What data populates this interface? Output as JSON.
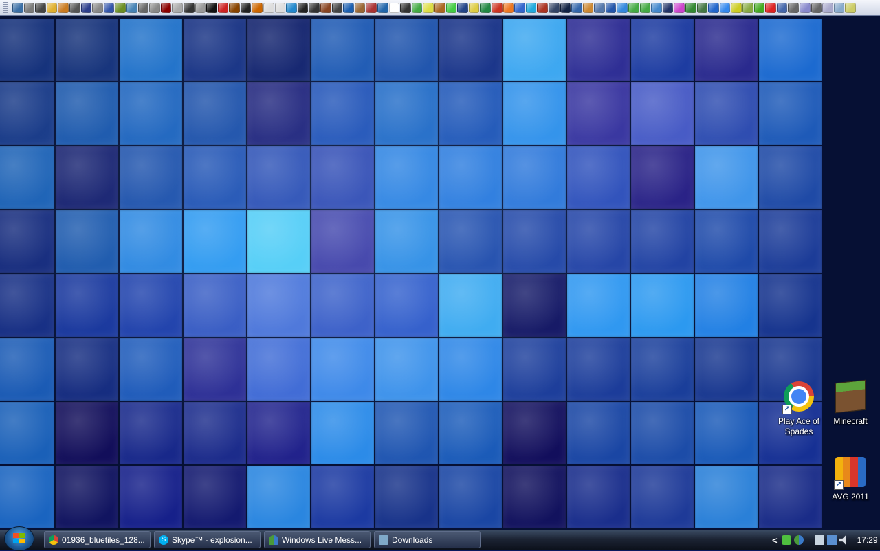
{
  "quicklaunch": {
    "icon_colors": [
      "#3a6ea5",
      "#7a7a7a",
      "#444444",
      "#e0b030",
      "#c97a20",
      "#555555",
      "#2c3e8c",
      "#888888",
      "#3355aa",
      "#6b8e23",
      "#4682b4",
      "#666666",
      "#888888",
      "#8b0000",
      "#aaaaaa",
      "#333333",
      "#999999",
      "#111111",
      "#cc2222",
      "#884400",
      "#222222",
      "#cc6600",
      "#dddddd",
      "#dddddd",
      "#2288cc",
      "#222222",
      "#333333",
      "#884422",
      "#444444",
      "#1c5fb0",
      "#996633",
      "#aa3333",
      "#2266aa",
      "#ffffff",
      "#333333",
      "#44aa44",
      "#dddd44",
      "#aa6622",
      "#44cc44",
      "#224488",
      "#ddcc44",
      "#228844",
      "#cc3322",
      "#ee7722",
      "#3366cc",
      "#22aadd",
      "#aa3322",
      "#334466",
      "#112244",
      "#3366aa",
      "#cc8833",
      "#5577aa",
      "#2255aa",
      "#3388dd",
      "#44aa44",
      "#44aa44",
      "#4488cc",
      "#223366",
      "#cc44cc",
      "#338833",
      "#447744",
      "#2266cc",
      "#3388ee",
      "#cccc22",
      "#88aa44",
      "#44aa22",
      "#dd2222",
      "#4466aa",
      "#666666",
      "#8888cc",
      "#666666",
      "#aaaacc",
      "#88aacc",
      "#cccc66"
    ]
  },
  "desktop_icons": [
    {
      "label": "Play Ace of Spades",
      "icon": "chrome-icon"
    },
    {
      "label": "Minecraft",
      "icon": "minecraft-icon"
    },
    {
      "label": "AVG 2011",
      "icon": "avg-icon"
    }
  ],
  "taskbar": {
    "buttons": [
      {
        "label": "01936_bluetiles_128...",
        "icon": "chrome-icon",
        "color": "#db4437"
      },
      {
        "label": "Skype™ - explosion...",
        "icon": "skype-icon",
        "color": "#00aff0"
      },
      {
        "label": "Windows Live Mess...",
        "icon": "messenger-icon",
        "color": "#4a9a3a"
      },
      {
        "label": "Downloads",
        "icon": "folder-icon",
        "color": "#7fa9c9"
      }
    ],
    "tray": {
      "chevron": "<",
      "icons": [
        "avg-tray-icon",
        "messenger-tray-icon",
        "usb-icon",
        "network-icon",
        "volume-icon"
      ],
      "clock": "17:29"
    }
  },
  "wallpaper": {
    "tile_colors": [
      [
        "#14307a",
        "#143078",
        "#1f70c8",
        "#152e80",
        "#0f1d68",
        "#1a55b0",
        "#1a4ea8",
        "#152e84",
        "#3aa6f0",
        "#2c2a92",
        "#1c3aa0",
        "#2a2a8e",
        "#1c6ad0"
      ],
      [
        "#173886",
        "#1a56aa",
        "#1c62bc",
        "#1b4da6",
        "#1e1e76",
        "#1f4fb4",
        "#1f68c4",
        "#1c52b4",
        "#2e90ea",
        "#36309c",
        "#4658c4",
        "#2e4cb0",
        "#1e5ab8"
      ],
      [
        "#1b60b4",
        "#161e6c",
        "#1c4ea8",
        "#1f4fb0",
        "#2a4ab0",
        "#2e44ae",
        "#2a80e0",
        "#2878dc",
        "#2a74d8",
        "#2c4cb8",
        "#261c82",
        "#3e94ea",
        "#1f4aa6"
      ],
      [
        "#14287a",
        "#1a56aa",
        "#2a86e0",
        "#2a98f0",
        "#50d0f6",
        "#3e38a2",
        "#2c8ce4",
        "#1e48a8",
        "#1e40a2",
        "#203ea2",
        "#1e3ea0",
        "#1d48a8",
        "#1c3c98"
      ],
      [
        "#152c82",
        "#16339a",
        "#1c3ca8",
        "#3456c0",
        "#4a72d8",
        "#3658c4",
        "#2e58c8",
        "#3aaaf0",
        "#10105e",
        "#2c96f0",
        "#2a98f0",
        "#2280e4",
        "#16348e"
      ],
      [
        "#1a5ab4",
        "#142a7e",
        "#1c58b8",
        "#2a2a92",
        "#3e68d4",
        "#3a86e8",
        "#3a90ea",
        "#2a84e6",
        "#1a3a98",
        "#1a3a98",
        "#1a3e9a",
        "#193890",
        "#1a3890"
      ],
      [
        "#1a60b8",
        "#120e5a",
        "#18288a",
        "#1b2a8a",
        "#20208a",
        "#2a8ae8",
        "#1e54b0",
        "#1a5ab8",
        "#120e5c",
        "#1a46a4",
        "#1c4ca8",
        "#1a5ab8",
        "#163094"
      ],
      [
        "#1a64c0",
        "#111460",
        "#16208a",
        "#141a70",
        "#2a86e0",
        "#1c3aa2",
        "#18338a",
        "#1a46a4",
        "#12125e",
        "#1a2e8c",
        "#1e3a98",
        "#2a80d8",
        "#1a2c88"
      ]
    ]
  }
}
